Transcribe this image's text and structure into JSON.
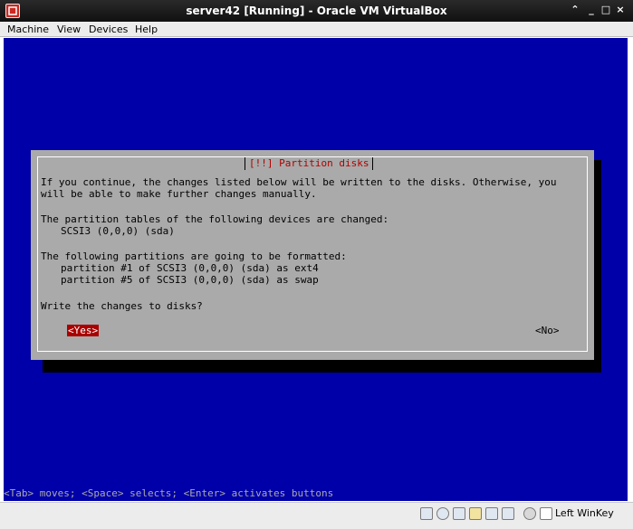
{
  "window": {
    "title": "server42 [Running] - Oracle VM VirtualBox",
    "controls": {
      "up": "⌃",
      "minimize": "_",
      "maximize": "□",
      "close": "×"
    }
  },
  "menu": {
    "items": [
      "Machine",
      "View",
      "Devices",
      "Help"
    ]
  },
  "dialog": {
    "title": "[!!] Partition disks",
    "intro_line1": "If you continue, the changes listed below will be written to the disks. Otherwise, you",
    "intro_line2": "will be able to make further changes manually.",
    "tables_heading": "The partition tables of the following devices are changed:",
    "device": "SCSI3 (0,0,0) (sda)",
    "format_heading": "The following partitions are going to be formatted:",
    "partition1": "partition #1 of SCSI3 (0,0,0) (sda) as ext4",
    "partition2": "partition #5 of SCSI3 (0,0,0) (sda) as swap",
    "question": "Write the changes to disks?",
    "yes_label": "<Yes>",
    "no_label": "<No>"
  },
  "helpline": "<Tab> moves; <Space> selects; <Enter> activates buttons",
  "statusbar": {
    "host_key": "Left WinKey",
    "icons": [
      "hard-disk-icon",
      "optical-drive-icon",
      "usb-icon",
      "shared-folders-icon",
      "display-icon",
      "video-capture-icon",
      "mouse-integration-icon",
      "host-key-icon"
    ]
  },
  "colors": {
    "vm_background": "#0000a8",
    "dialog_gray": "#aaaaaa",
    "yes_highlight": "#aa0000",
    "title_red": "#b00000"
  }
}
